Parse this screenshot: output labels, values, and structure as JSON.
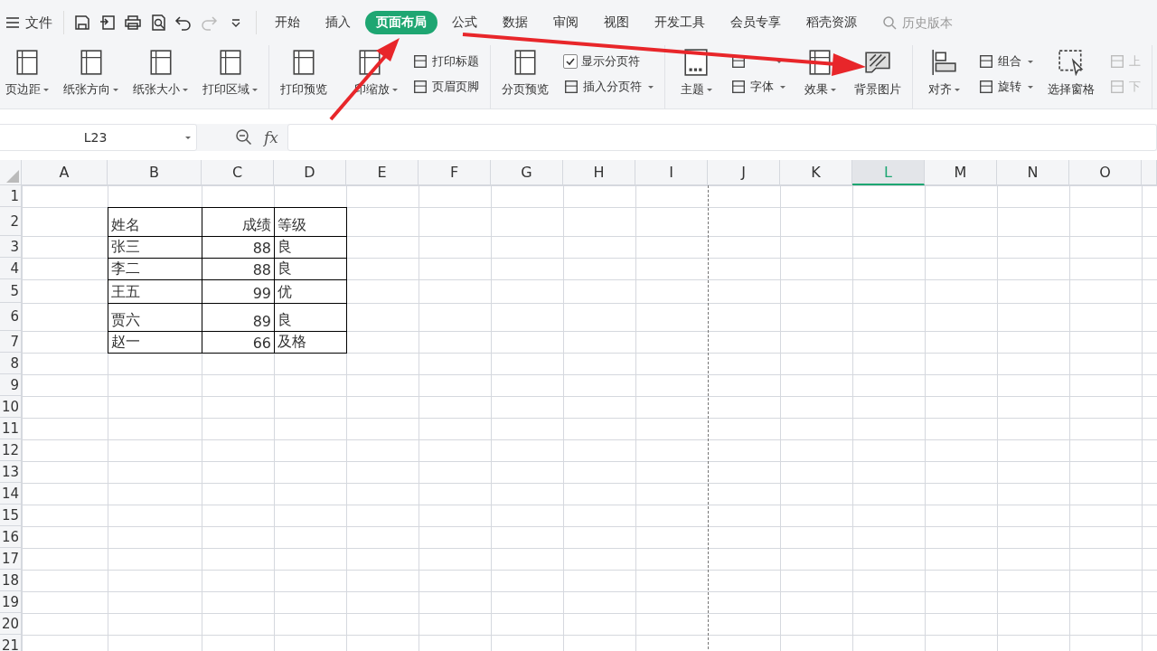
{
  "menu": {
    "label": "文件"
  },
  "tabs": [
    {
      "label": "开始",
      "selected": false
    },
    {
      "label": "插入",
      "selected": false
    },
    {
      "label": "页面布局",
      "selected": true
    },
    {
      "label": "公式",
      "selected": false
    },
    {
      "label": "数据",
      "selected": false
    },
    {
      "label": "审阅",
      "selected": false
    },
    {
      "label": "视图",
      "selected": false
    },
    {
      "label": "开发工具",
      "selected": false
    },
    {
      "label": "会员专享",
      "selected": false
    },
    {
      "label": "稻壳资源",
      "selected": false
    }
  ],
  "search": {
    "placeholder": "历史版本"
  },
  "ribbon": [
    {
      "items": [
        {
          "kind": "large",
          "label": "页边距",
          "dropdown": true
        },
        {
          "kind": "large",
          "label": "纸张方向",
          "dropdown": true
        },
        {
          "kind": "large",
          "label": "纸张大小",
          "dropdown": true
        },
        {
          "kind": "large",
          "label": "打印区域",
          "dropdown": true
        }
      ]
    },
    {
      "items": [
        {
          "kind": "large",
          "label": "打印预览",
          "dropdown": false
        },
        {
          "kind": "large",
          "label": "印缩放",
          "dropdown": true
        },
        {
          "kind": "stack",
          "children": [
            {
              "kind": "small",
              "label": "打印标题",
              "dropdown": false
            },
            {
              "kind": "small",
              "label": "页眉页脚",
              "dropdown": false
            }
          ]
        }
      ]
    },
    {
      "items": [
        {
          "kind": "large",
          "label": "分页预览",
          "dropdown": false
        },
        {
          "kind": "stack",
          "children": [
            {
              "kind": "check",
              "label": "显示分页符",
              "checked": true
            },
            {
              "kind": "small",
              "label": "插入分页符",
              "dropdown": true
            }
          ]
        }
      ]
    },
    {
      "items": [
        {
          "kind": "large",
          "label": "主题",
          "dropdown": true
        },
        {
          "kind": "stack",
          "children": [
            {
              "kind": "small",
              "dropdown": true
            },
            {
              "kind": "small",
              "label": "字体",
              "dropdown": true
            }
          ]
        },
        {
          "kind": "large",
          "label": "效果",
          "dropdown": true
        },
        {
          "kind": "large",
          "label": "背景图片",
          "dropdown": false
        }
      ]
    },
    {
      "items": [
        {
          "kind": "large",
          "label": "对齐",
          "dropdown": true
        },
        {
          "kind": "stack",
          "children": [
            {
              "kind": "small",
              "label": "组合",
              "dropdown": true
            },
            {
              "kind": "small",
              "label": "旋转",
              "dropdown": true
            }
          ]
        },
        {
          "kind": "large",
          "label": "选择窗格",
          "dropdown": false
        },
        {
          "kind": "stack",
          "children": [
            {
              "kind": "small",
              "label": "上",
              "dropdown": false,
              "disabled": true
            },
            {
              "kind": "small",
              "label": "下",
              "dropdown": false,
              "disabled": true
            }
          ]
        }
      ]
    }
  ],
  "name_box": {
    "value": "L23"
  },
  "formula_bar": {
    "label": "fx"
  },
  "columns": [
    {
      "label": "A",
      "selected": false
    },
    {
      "label": "B",
      "selected": false
    },
    {
      "label": "C",
      "selected": false
    },
    {
      "label": "D",
      "selected": false
    },
    {
      "label": "E",
      "selected": false
    },
    {
      "label": "F",
      "selected": false
    },
    {
      "label": "G",
      "selected": false
    },
    {
      "label": "H",
      "selected": false
    },
    {
      "label": "I",
      "selected": false
    },
    {
      "label": "J",
      "selected": false
    },
    {
      "label": "K",
      "selected": false
    },
    {
      "label": "L",
      "selected": true
    },
    {
      "label": "M",
      "selected": false
    },
    {
      "label": "N",
      "selected": false
    },
    {
      "label": "O",
      "selected": false
    }
  ],
  "rows": [
    "1",
    "2",
    "3",
    "4",
    "5",
    "6",
    "7",
    "8",
    "9",
    "10",
    "11",
    "12",
    "13",
    "14",
    "15",
    "16",
    "17",
    "18",
    "19",
    "20",
    "21"
  ],
  "table": {
    "header": [
      "姓名",
      "成绩",
      "等级"
    ],
    "rows": [
      [
        "张三",
        "88",
        "良"
      ],
      [
        "李二",
        "88",
        "良"
      ],
      [
        "王五",
        "99",
        "优"
      ],
      [
        "贾六",
        "89",
        "良"
      ],
      [
        "赵一",
        "66",
        "及格"
      ]
    ]
  }
}
